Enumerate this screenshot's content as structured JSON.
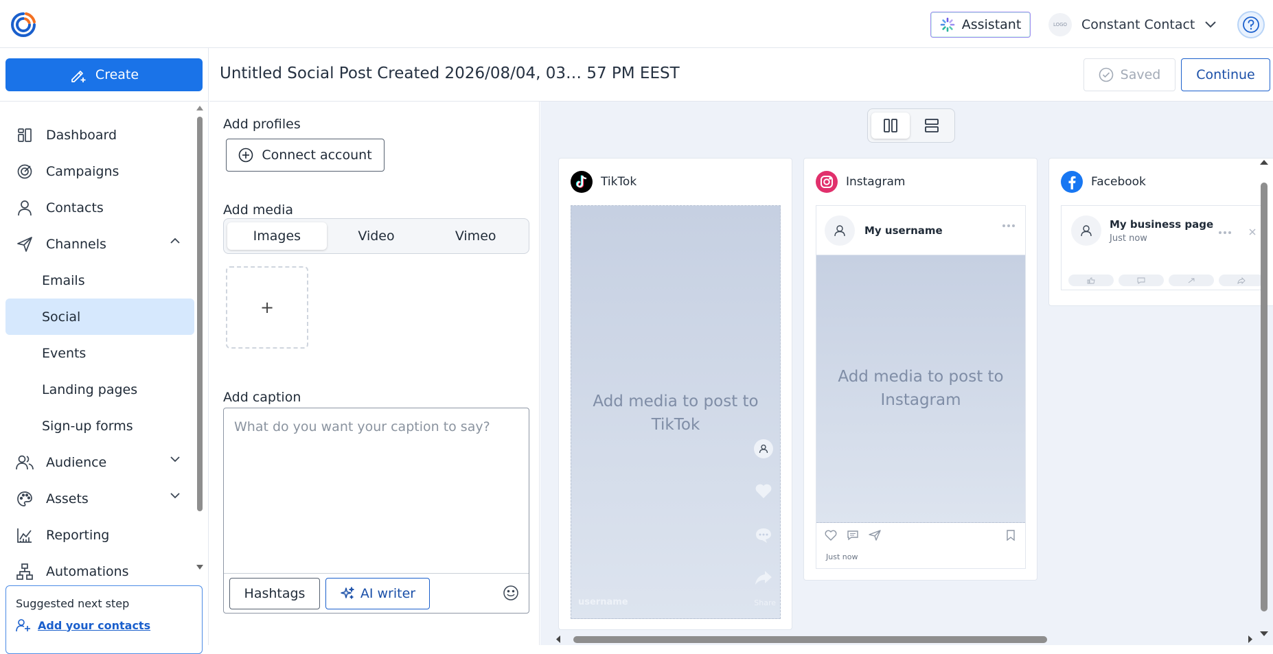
{
  "topbar": {
    "assistant_label": "Assistant",
    "account_logo_text": "LOGO",
    "account_name": "Constant Contact"
  },
  "sidebar": {
    "create_label": "Create",
    "items": [
      {
        "label": "Dashboard",
        "icon": "dashboard-icon"
      },
      {
        "label": "Campaigns",
        "icon": "target-icon"
      },
      {
        "label": "Contacts",
        "icon": "person-icon"
      },
      {
        "label": "Channels",
        "icon": "send-icon",
        "expanded": true
      },
      {
        "label": "Emails"
      },
      {
        "label": "Social",
        "active": true
      },
      {
        "label": "Events"
      },
      {
        "label": "Landing pages"
      },
      {
        "label": "Sign-up forms"
      },
      {
        "label": "Audience",
        "icon": "people-icon",
        "expanded": false
      },
      {
        "label": "Assets",
        "icon": "palette-icon",
        "expanded": false
      },
      {
        "label": "Reporting",
        "icon": "chart-icon"
      },
      {
        "label": "Automations",
        "icon": "flow-icon"
      }
    ],
    "suggest": {
      "title": "Suggested next step",
      "link": "Add your contacts"
    }
  },
  "header": {
    "title": "Untitled Social Post Created 2026/08/04, 03… 57 PM EEST",
    "saved_label": "Saved",
    "continue_label": "Continue"
  },
  "editor": {
    "add_profiles": "Add profiles",
    "connect_account": "Connect account",
    "add_media": "Add media",
    "media_tabs": [
      "Images",
      "Video",
      "Vimeo"
    ],
    "active_media_tab": "Images",
    "add_media_plus": "+",
    "add_caption": "Add caption",
    "caption_placeholder": "What do you want your caption to say?",
    "hashtags_label": "Hashtags",
    "ai_writer_label": "AI writer"
  },
  "preview": {
    "tiktok": {
      "name": "TikTok",
      "media_message": "Add media to post to TikTok",
      "username": "username",
      "share": "Share"
    },
    "instagram": {
      "name": "Instagram",
      "username": "My username",
      "media_message": "Add media to post to Instagram",
      "time": "Just now"
    },
    "facebook": {
      "name": "Facebook",
      "page_name": "My business page",
      "time": "Just now"
    }
  },
  "colors": {
    "primary": "#1a73e8",
    "active_nav": "#d6e8fd",
    "preview_bg": "#eef2f9",
    "tiktok": "#000000",
    "instagram": "#e1306c",
    "facebook": "#1877f2"
  }
}
